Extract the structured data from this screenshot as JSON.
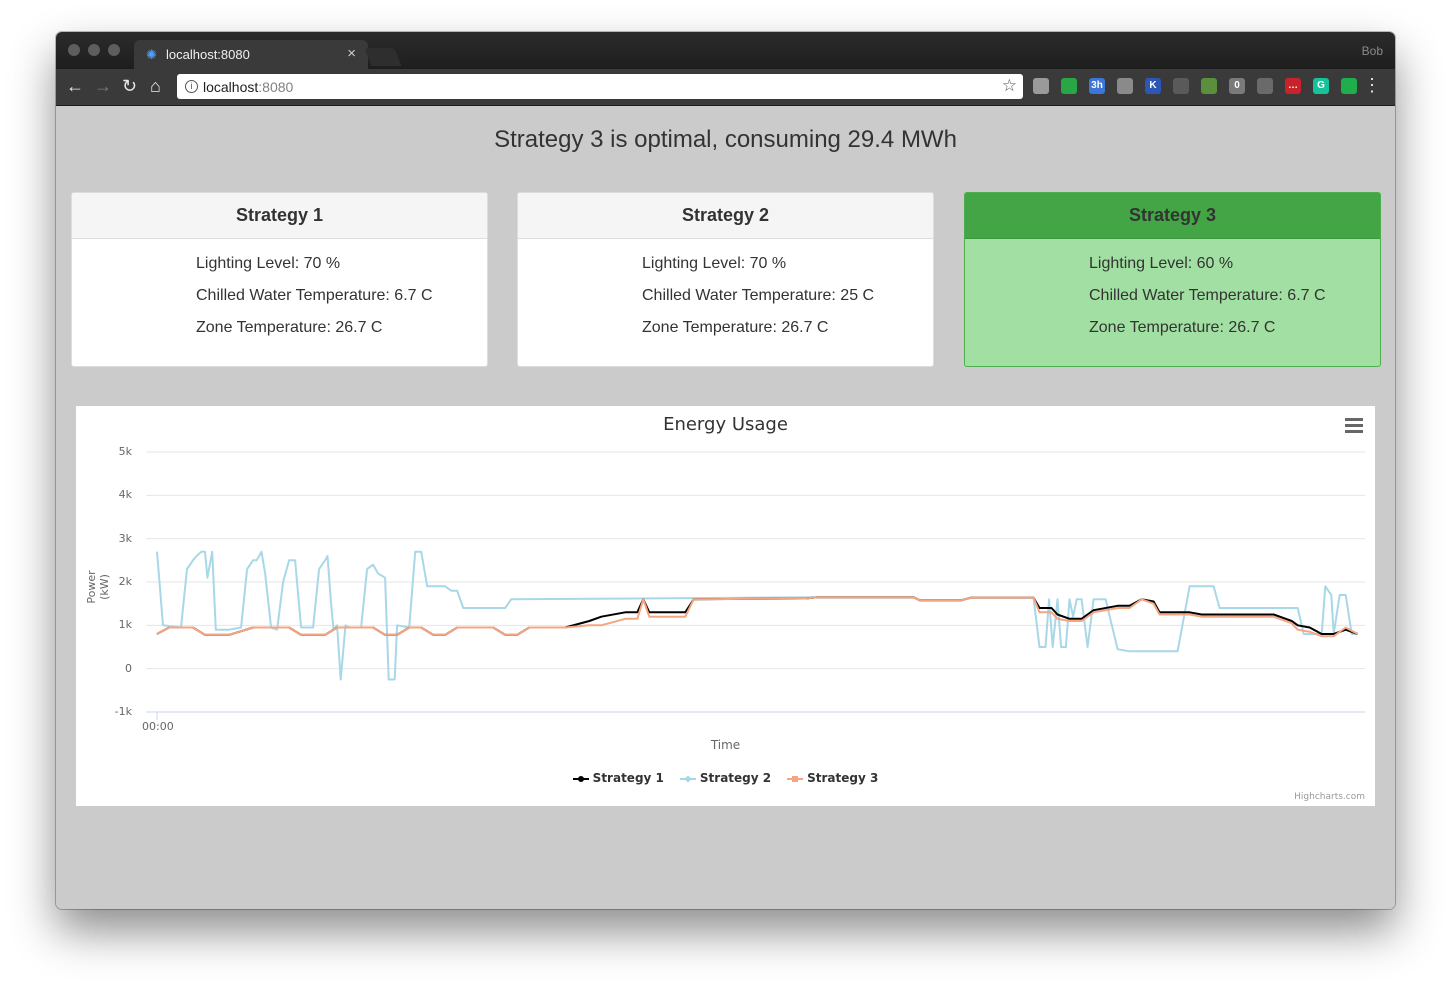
{
  "browser": {
    "tab_title": "localhost:8080",
    "profile": "Bob",
    "url_host": "localhost",
    "url_port": ":8080",
    "extensions": [
      {
        "name": "pocket-icon",
        "color": "#9a9a9a",
        "glyph": ""
      },
      {
        "name": "grid-app-icon",
        "color": "#29a745",
        "glyph": ""
      },
      {
        "name": "calendar-icon",
        "color": "#3c76d6",
        "glyph": "3h"
      },
      {
        "name": "calculator-icon",
        "color": "#8a8a8a",
        "glyph": ""
      },
      {
        "name": "k-extension-icon",
        "color": "#2c57b5",
        "glyph": "K"
      },
      {
        "name": "cast-icon",
        "color": "#5a5a5a",
        "glyph": ""
      },
      {
        "name": "evernote-icon",
        "color": "#5a8f3c",
        "glyph": ""
      },
      {
        "name": "ghostery-icon",
        "color": "#7a7a7a",
        "glyph": "0"
      },
      {
        "name": "recycle-icon",
        "color": "#6a6a6a",
        "glyph": ""
      },
      {
        "name": "lastpass-icon",
        "color": "#c8222b",
        "glyph": "…"
      },
      {
        "name": "grammarly-icon",
        "color": "#15c39a",
        "glyph": "G"
      },
      {
        "name": "green-drop-icon",
        "color": "#1fae4b",
        "glyph": ""
      }
    ]
  },
  "headline": "Strategy 3 is optimal, consuming 29.4 MWh",
  "strategies": [
    {
      "title": "Strategy 1",
      "lighting": "Lighting Level: 70 %",
      "chilled": "Chilled Water Temperature: 6.7 C",
      "zone": "Zone Temperature: 26.7 C"
    },
    {
      "title": "Strategy 2",
      "lighting": "Lighting Level: 70 %",
      "chilled": "Chilled Water Temperature: 25 C",
      "zone": "Zone Temperature: 26.7 C"
    },
    {
      "title": "Strategy 3",
      "lighting": "Lighting Level: 60 %",
      "chilled": "Chilled Water Temperature: 6.7 C",
      "zone": "Zone Temperature: 26.7 C"
    }
  ],
  "colors": {
    "optimal_header": "#43a546",
    "optimal_body": "#a2dfa2"
  },
  "chart_data": {
    "type": "line",
    "title": "Energy Usage",
    "xlabel": "Time",
    "ylabel": "Power (kW)",
    "x_tick_labels": [
      "00:00"
    ],
    "y_tick_labels": [
      "5k",
      "4k",
      "3k",
      "2k",
      "1k",
      "0",
      "-1k"
    ],
    "ylim": [
      -1000,
      5000
    ],
    "xlim": [
      0,
      100
    ],
    "credits": "Highcharts.com",
    "grid": true,
    "legend_position": "bottom",
    "series": [
      {
        "name": "Strategy 1",
        "color": "#000000",
        "points": [
          [
            0,
            800
          ],
          [
            1,
            950
          ],
          [
            3,
            950
          ],
          [
            4,
            780
          ],
          [
            6,
            780
          ],
          [
            8,
            950
          ],
          [
            11,
            950
          ],
          [
            12,
            780
          ],
          [
            14,
            780
          ],
          [
            15,
            950
          ],
          [
            18,
            950
          ],
          [
            19,
            780
          ],
          [
            20,
            780
          ],
          [
            21,
            950
          ],
          [
            22,
            950
          ],
          [
            23,
            780
          ],
          [
            24,
            780
          ],
          [
            25,
            950
          ],
          [
            28,
            950
          ],
          [
            29,
            780
          ],
          [
            30,
            780
          ],
          [
            31,
            950
          ],
          [
            34,
            950
          ],
          [
            36,
            1100
          ],
          [
            37,
            1200
          ],
          [
            39,
            1300
          ],
          [
            40,
            1300
          ],
          [
            40.5,
            1600
          ],
          [
            41,
            1300
          ],
          [
            44,
            1300
          ],
          [
            44.7,
            1600
          ],
          [
            54,
            1620
          ],
          [
            55,
            1650
          ],
          [
            63,
            1650
          ],
          [
            63.5,
            1580
          ],
          [
            67,
            1580
          ],
          [
            67.8,
            1640
          ],
          [
            73,
            1640
          ],
          [
            73.5,
            1400
          ],
          [
            74.5,
            1400
          ],
          [
            75,
            1250
          ],
          [
            76,
            1150
          ],
          [
            77,
            1150
          ],
          [
            78,
            1350
          ],
          [
            80,
            1450
          ],
          [
            81,
            1450
          ],
          [
            82,
            1600
          ],
          [
            83,
            1550
          ],
          [
            83.5,
            1300
          ],
          [
            86,
            1300
          ],
          [
            87,
            1250
          ],
          [
            93,
            1250
          ],
          [
            94,
            1150
          ],
          [
            94.5,
            1100
          ],
          [
            95,
            1000
          ],
          [
            96,
            950
          ],
          [
            97,
            800
          ],
          [
            98,
            800
          ],
          [
            99,
            900
          ],
          [
            100,
            800
          ]
        ]
      },
      {
        "name": "Strategy 2",
        "color": "#a8d8e8",
        "points": [
          [
            0,
            2700
          ],
          [
            0.5,
            1000
          ],
          [
            2,
            950
          ],
          [
            2.5,
            2300
          ],
          [
            3,
            2500
          ],
          [
            3.3,
            2600
          ],
          [
            3.7,
            2700
          ],
          [
            4,
            2700
          ],
          [
            4.2,
            2100
          ],
          [
            4.6,
            2700
          ],
          [
            4.9,
            900
          ],
          [
            6,
            900
          ],
          [
            7,
            950
          ],
          [
            7.5,
            2300
          ],
          [
            8,
            2500
          ],
          [
            8.3,
            2500
          ],
          [
            8.7,
            2700
          ],
          [
            9,
            2200
          ],
          [
            9.5,
            950
          ],
          [
            10,
            900
          ],
          [
            10.5,
            2000
          ],
          [
            11,
            2500
          ],
          [
            11.5,
            2500
          ],
          [
            12,
            950
          ],
          [
            13,
            950
          ],
          [
            13.5,
            2300
          ],
          [
            14,
            2500
          ],
          [
            14.2,
            2600
          ],
          [
            14.5,
            1500
          ],
          [
            14.7,
            900
          ],
          [
            15,
            1000
          ],
          [
            15.3,
            -250
          ],
          [
            15.7,
            1000
          ],
          [
            16,
            950
          ],
          [
            17,
            950
          ],
          [
            17.5,
            2300
          ],
          [
            18,
            2400
          ],
          [
            18.4,
            2200
          ],
          [
            19,
            2100
          ],
          [
            19.3,
            -250
          ],
          [
            19.8,
            -250
          ],
          [
            20,
            1000
          ],
          [
            21,
            950
          ],
          [
            21.5,
            2700
          ],
          [
            22,
            2700
          ],
          [
            22.5,
            1900
          ],
          [
            24,
            1900
          ],
          [
            24.5,
            1800
          ],
          [
            25,
            1800
          ],
          [
            25.5,
            1400
          ],
          [
            29,
            1400
          ],
          [
            29.5,
            1600
          ],
          [
            55,
            1650
          ],
          [
            63,
            1650
          ],
          [
            63.5,
            1580
          ],
          [
            67,
            1580
          ],
          [
            67.8,
            1640
          ],
          [
            73,
            1640
          ],
          [
            73.5,
            500
          ],
          [
            74,
            500
          ],
          [
            74.3,
            1600
          ],
          [
            74.6,
            500
          ],
          [
            75,
            1600
          ],
          [
            75.3,
            500
          ],
          [
            75.7,
            500
          ],
          [
            76,
            1600
          ],
          [
            76.3,
            1200
          ],
          [
            76.6,
            1600
          ],
          [
            77,
            1600
          ],
          [
            77.5,
            500
          ],
          [
            78,
            1600
          ],
          [
            79,
            1600
          ],
          [
            80,
            450
          ],
          [
            81,
            400
          ],
          [
            85,
            400
          ],
          [
            86,
            1900
          ],
          [
            88,
            1900
          ],
          [
            88.5,
            1400
          ],
          [
            95,
            1400
          ],
          [
            95.5,
            800
          ],
          [
            97,
            800
          ],
          [
            97.3,
            1900
          ],
          [
            97.8,
            1700
          ],
          [
            98,
            800
          ],
          [
            98.5,
            1700
          ],
          [
            99,
            1700
          ],
          [
            99.5,
            800
          ],
          [
            100,
            800
          ]
        ]
      },
      {
        "name": "Strategy 3",
        "color": "#f4a582",
        "points": [
          [
            0,
            800
          ],
          [
            1,
            950
          ],
          [
            3,
            950
          ],
          [
            4,
            780
          ],
          [
            6,
            780
          ],
          [
            8,
            950
          ],
          [
            11,
            950
          ],
          [
            12,
            780
          ],
          [
            14,
            780
          ],
          [
            15,
            950
          ],
          [
            18,
            950
          ],
          [
            19,
            780
          ],
          [
            20,
            780
          ],
          [
            21,
            950
          ],
          [
            22,
            950
          ],
          [
            23,
            780
          ],
          [
            24,
            780
          ],
          [
            25,
            950
          ],
          [
            28,
            950
          ],
          [
            29,
            780
          ],
          [
            30,
            780
          ],
          [
            31,
            950
          ],
          [
            34,
            950
          ],
          [
            36,
            1000
          ],
          [
            37,
            1000
          ],
          [
            39,
            1150
          ],
          [
            40,
            1150
          ],
          [
            40.5,
            1600
          ],
          [
            41,
            1200
          ],
          [
            44,
            1200
          ],
          [
            44.7,
            1600
          ],
          [
            54,
            1620
          ],
          [
            55,
            1650
          ],
          [
            63,
            1650
          ],
          [
            63.5,
            1580
          ],
          [
            67,
            1580
          ],
          [
            67.8,
            1640
          ],
          [
            73,
            1640
          ],
          [
            73.5,
            1300
          ],
          [
            74.5,
            1300
          ],
          [
            75,
            1150
          ],
          [
            76,
            1100
          ],
          [
            77,
            1100
          ],
          [
            78,
            1300
          ],
          [
            80,
            1400
          ],
          [
            81,
            1400
          ],
          [
            82,
            1600
          ],
          [
            83,
            1500
          ],
          [
            83.5,
            1250
          ],
          [
            86,
            1250
          ],
          [
            87,
            1200
          ],
          [
            93,
            1200
          ],
          [
            94,
            1100
          ],
          [
            94.5,
            1050
          ],
          [
            95,
            900
          ],
          [
            96,
            850
          ],
          [
            97,
            750
          ],
          [
            98,
            750
          ],
          [
            99,
            950
          ],
          [
            100,
            800
          ]
        ]
      }
    ]
  }
}
